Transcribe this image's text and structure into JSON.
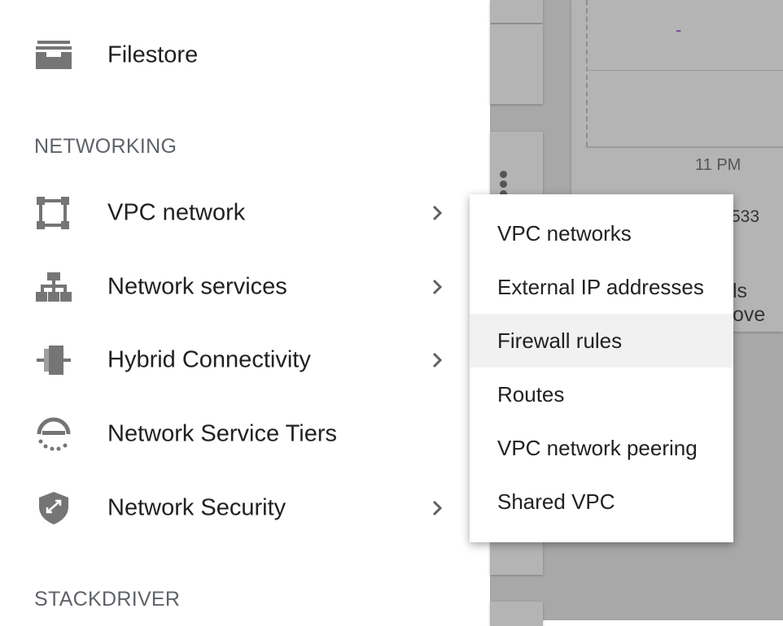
{
  "drawer": {
    "filestore": {
      "label": "Filestore",
      "icon": "filestore-icon"
    },
    "networking_section": "NETWORKING",
    "items": [
      {
        "label": "VPC network",
        "icon": "vpc-network-icon",
        "has_submenu": true
      },
      {
        "label": "Network services",
        "icon": "network-services-icon",
        "has_submenu": true
      },
      {
        "label": "Hybrid Connectivity",
        "icon": "hybrid-connectivity-icon",
        "has_submenu": true
      },
      {
        "label": "Network Service Tiers",
        "icon": "network-service-tiers-icon",
        "has_submenu": false
      },
      {
        "label": "Network Security",
        "icon": "network-security-icon",
        "has_submenu": true
      }
    ],
    "stackdriver_section": "STACKDRIVER"
  },
  "background": {
    "dash": "-",
    "time_label": "11 PM",
    "value_fragment": "533",
    "text_fragment": "ls ove"
  },
  "flyout": {
    "items": [
      {
        "label": "VPC networks"
      },
      {
        "label": "External IP addresses"
      },
      {
        "label": "Firewall rules",
        "highlighted": true
      },
      {
        "label": "Routes"
      },
      {
        "label": "VPC network peering"
      },
      {
        "label": "Shared VPC"
      }
    ]
  },
  "colors": {
    "icon_gray": "#757575",
    "text_primary": "#212121",
    "section_text": "#5f6368",
    "backdrop": "#a8a8a8",
    "highlight": "#f1f1f1",
    "chart_dash": "#7b3fa0"
  }
}
